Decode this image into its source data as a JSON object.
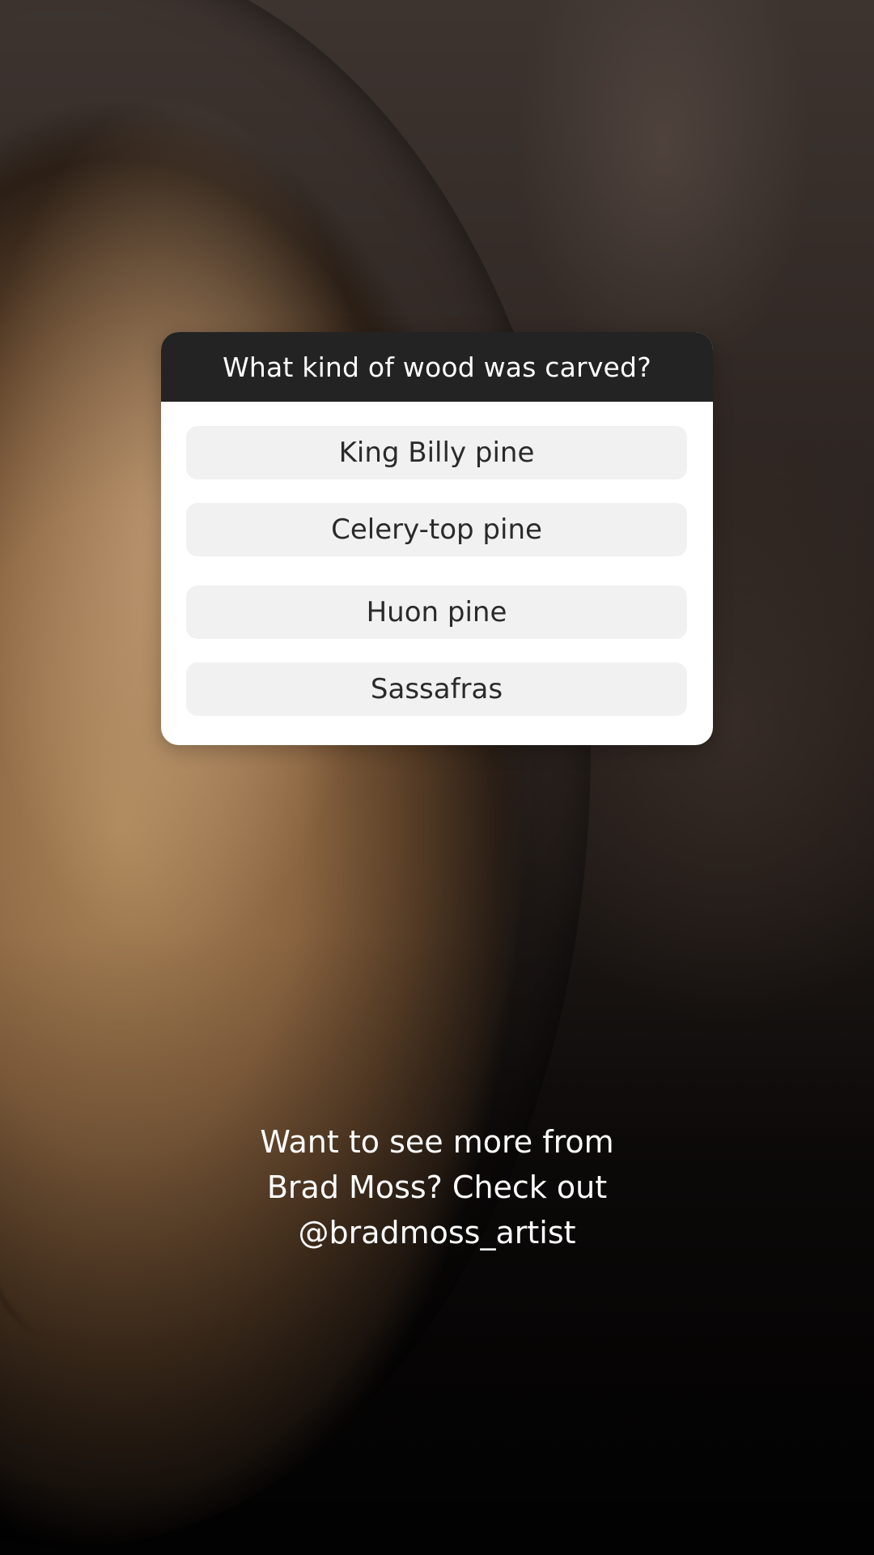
{
  "quiz": {
    "question": "What kind of wood was carved?",
    "options": [
      {
        "label": "King Billy pine"
      },
      {
        "label": "Celery-top pine"
      },
      {
        "label": "Huon pine"
      },
      {
        "label": "Sassafras"
      }
    ]
  },
  "caption": {
    "lines": [
      "Want to see more from",
      "Brad Moss? Check out",
      "@bradmoss_artist"
    ]
  },
  "colors": {
    "quiz_header_bg": "#232323",
    "quiz_card_bg": "#ffffff",
    "option_bg": "#f1f1f1",
    "caption_text": "#ffffff"
  },
  "background": {
    "image": "carved-wood-sculpture-photo"
  }
}
